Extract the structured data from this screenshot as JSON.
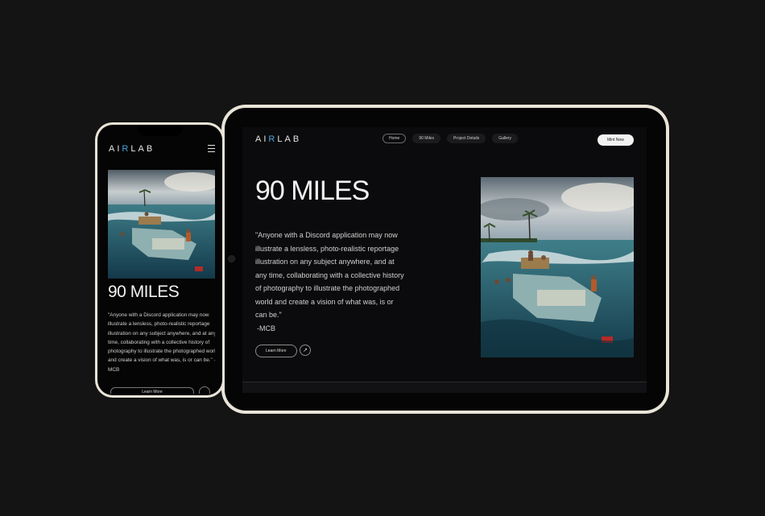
{
  "brand": {
    "logo_pre": "AI",
    "logo_accent": "R",
    "logo_post": "LAB"
  },
  "tablet": {
    "nav": [
      {
        "label": "Home",
        "active": true
      },
      {
        "label": "90 Miles",
        "active": false
      },
      {
        "label": "Project Details",
        "active": false
      },
      {
        "label": "Gallery",
        "active": false
      }
    ],
    "mint_label": "Mint Now",
    "title": "90 MILES",
    "quote": "\"Anyone with a Discord application may now illustrate a lensless, photo-realistic reportage illustration on any subject anywhere, and at any time, collaborating with a collective history of photography to illustrate the photographed world and create a vision of what was, is or can be.\"",
    "attribution": "-MCB",
    "learn_more": "Learn More",
    "arrow_icon": "arrow-up-right-icon"
  },
  "phone": {
    "title": "90 MILES",
    "quote": "\"Anyone with a Discord application may now illustrate a lensless, photo-realistic reportage illustration on any subject anywhere, and at any time, collaborating with a collective history of photography to illustrate the photographed world and create a vision of what was, is or can be.\"",
    "attribution": "-MCB",
    "learn_more": "Learn More",
    "menu_icon": "hamburger-menu-icon"
  },
  "colors": {
    "background": "#141414",
    "device_frame": "#e9e4d8",
    "screen": "#0b0b0d",
    "accent": "#4aa3d8"
  }
}
